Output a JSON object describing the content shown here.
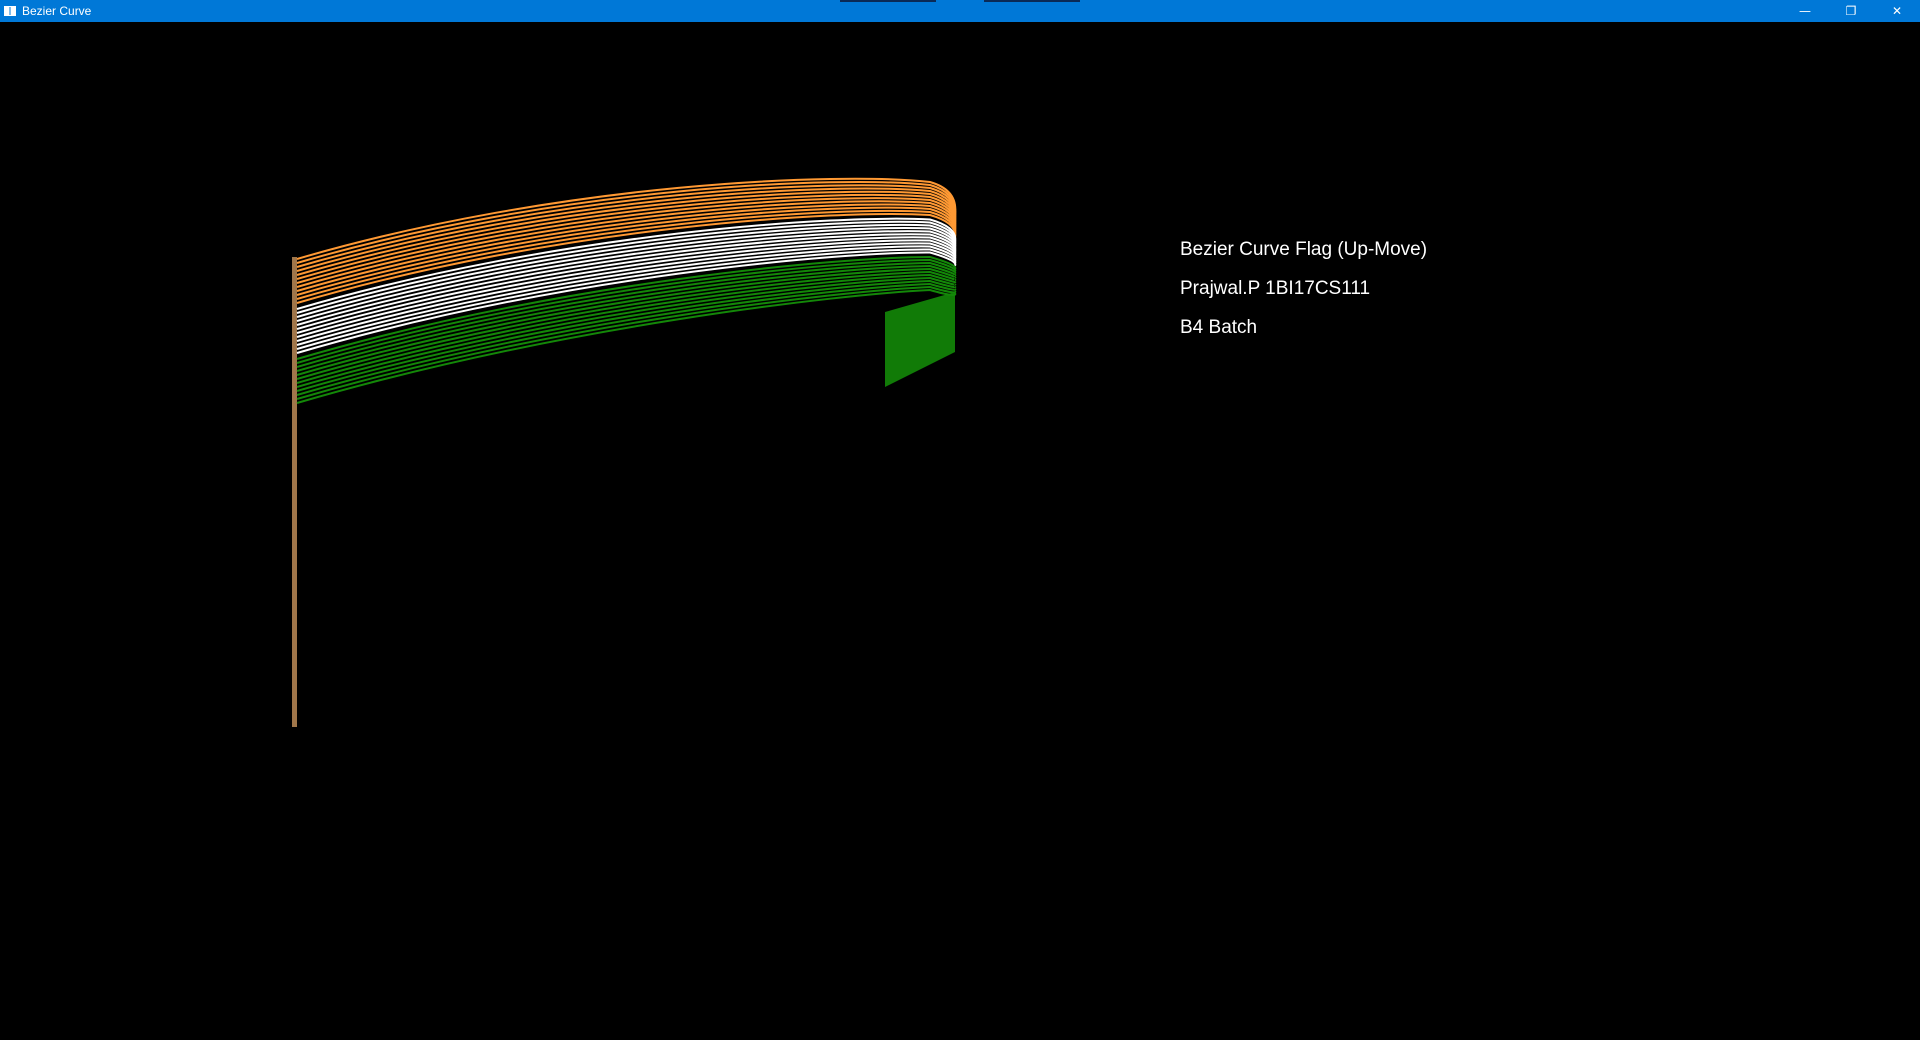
{
  "window": {
    "title": "Bezier Curve",
    "controls": {
      "minimize_glyph": "—",
      "maximize_glyph": "❐",
      "close_glyph": "✕"
    }
  },
  "canvas": {
    "background": "#000000",
    "text_lines": [
      "Bezier Curve Flag (Up-Move)",
      "Prajwal.P 1BI17CS111",
      "B4 Batch"
    ],
    "text_color": "#ffffff"
  },
  "flag": {
    "stripes": [
      {
        "name": "saffron",
        "color": "#ff9933"
      },
      {
        "name": "white",
        "color": "#ffffff"
      },
      {
        "name": "green",
        "color": "#138808"
      }
    ],
    "pole_color": "#a0764a"
  },
  "colors": {
    "titlebar": "#0078d7"
  }
}
